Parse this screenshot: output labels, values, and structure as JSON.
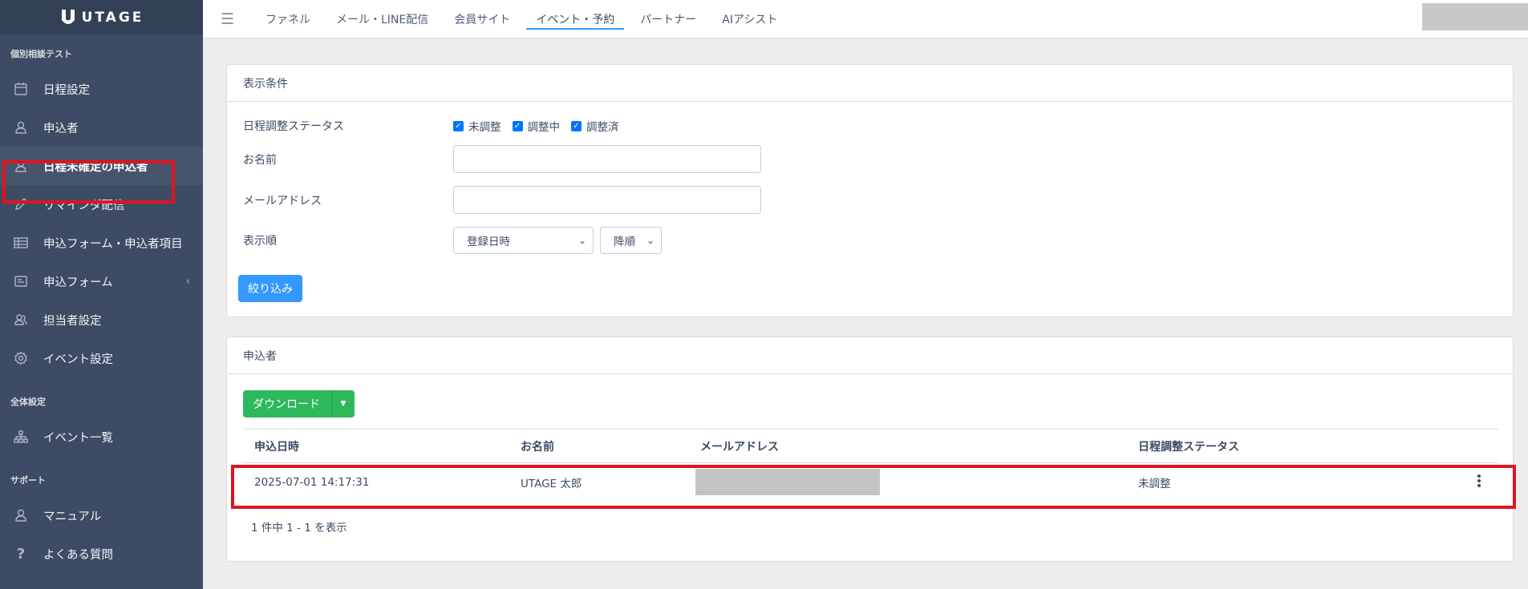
{
  "brand": {
    "name": "UTAGE"
  },
  "sidebar": {
    "section1_title": "個別相談テスト",
    "items1": [
      {
        "label": "日程設定",
        "icon": "calendar-icon"
      },
      {
        "label": "申込者",
        "icon": "user-icon"
      },
      {
        "label": "日程未確定の申込者",
        "icon": "user-icon"
      },
      {
        "label": "リマインダ配信",
        "icon": "pencil-icon"
      },
      {
        "label": "申込フォーム・申込者項目",
        "icon": "table-icon"
      },
      {
        "label": "申込フォーム",
        "icon": "form-icon"
      },
      {
        "label": "担当者設定",
        "icon": "users-icon"
      },
      {
        "label": "イベント設定",
        "icon": "gear-icon"
      }
    ],
    "section2_title": "全体設定",
    "items2": [
      {
        "label": "イベント一覧",
        "icon": "sitemap-icon"
      }
    ],
    "section3_title": "サポート",
    "items3": [
      {
        "label": "マニュアル",
        "icon": "user-icon"
      },
      {
        "label": "よくある質問",
        "icon": "question-icon"
      }
    ]
  },
  "topnav": {
    "tabs": [
      "ファネル",
      "メール・LINE配信",
      "会員サイト",
      "イベント・予約",
      "パートナー",
      "AIアシスト"
    ],
    "active_index": 3
  },
  "filter": {
    "title": "表示条件",
    "status_label": "日程調整ステータス",
    "status_options": [
      "未調整",
      "調整中",
      "調整済"
    ],
    "name_label": "お名前",
    "email_label": "メールアドレス",
    "order_label": "表示順",
    "order_field": "登録日時",
    "order_direction": "降順",
    "submit_label": "絞り込み"
  },
  "applicants": {
    "title": "申込者",
    "download_label": "ダウンロード",
    "columns": [
      "申込日時",
      "お名前",
      "メールアドレス",
      "日程調整ステータス"
    ],
    "rows": [
      {
        "date": "2025-07-01 14:17:31",
        "name": "UTAGE 太郎",
        "email": "",
        "status": "未調整"
      }
    ],
    "count_text": "1 件中 1 - 1 を表示"
  }
}
